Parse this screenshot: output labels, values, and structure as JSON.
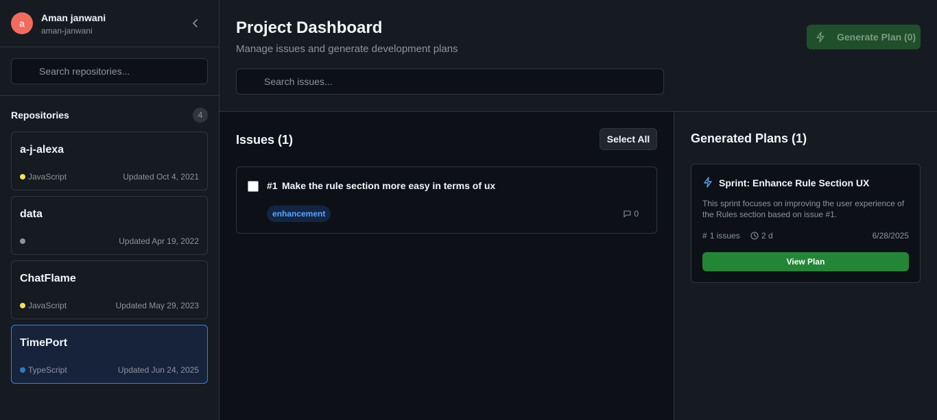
{
  "colors": {
    "accent_blue": "#2f81f7",
    "primary_green": "#238636",
    "avatar_bg": "#f16c5d",
    "javascript": "#f1e05a",
    "typescript": "#3178c6",
    "no_language": "#8b949e"
  },
  "user": {
    "initial": "a",
    "name": "Aman janwani",
    "handle": "aman-janwani"
  },
  "sidebar": {
    "search_placeholder": "Search repositories...",
    "repos_title": "Repositories",
    "repos_count": "4",
    "repos": [
      {
        "name": "a-j-alexa",
        "language": "JavaScript",
        "lang_color": "#f1e05a",
        "updated": "Updated Oct 4, 2021",
        "active": false
      },
      {
        "name": "data",
        "language": "",
        "lang_color": "#8b949e",
        "updated": "Updated Apr 19, 2022",
        "active": false
      },
      {
        "name": "ChatFlame",
        "language": "JavaScript",
        "lang_color": "#f1e05a",
        "updated": "Updated May 29, 2023",
        "active": false
      },
      {
        "name": "TimePort",
        "language": "TypeScript",
        "lang_color": "#3178c6",
        "updated": "Updated Jun 24, 2025",
        "active": true
      }
    ]
  },
  "header": {
    "title": "Project Dashboard",
    "subtitle": "Manage issues and generate development plans",
    "search_placeholder": "Search issues...",
    "generate_label": "Generate Plan (0)"
  },
  "issues": {
    "title": "Issues (1)",
    "select_all_label": "Select All",
    "items": [
      {
        "number": "#1",
        "title": "Make the rule section more easy in terms of ux",
        "label": "enhancement",
        "comments": "0"
      }
    ]
  },
  "plans": {
    "title": "Generated Plans (1)",
    "items": [
      {
        "title": "Sprint: Enhance Rule Section UX",
        "description": "This sprint focuses on improving the user experience of the Rules section based on issue #1.",
        "issues": "1 issues",
        "duration": "2 d",
        "date": "6/28/2025",
        "view_label": "View Plan"
      }
    ]
  }
}
